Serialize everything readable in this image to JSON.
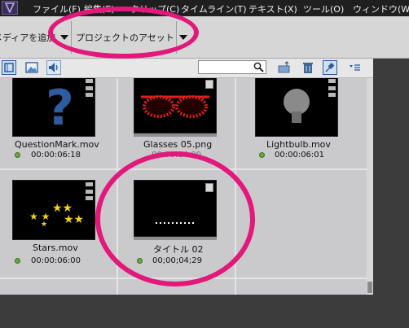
{
  "menu": {
    "items": [
      "ファイル(F)",
      "編集(E)",
      "クリップ(C)",
      "タイムライン(T)",
      "テキスト(X)",
      "ツール(O)",
      "ウィンドウ(W)"
    ]
  },
  "toolbar": {
    "add_media_label": "メディアを追加",
    "project_assets_label": "プロジェクトのアセット"
  },
  "search": {
    "value": ""
  },
  "assets": [
    {
      "name": "QuestionMark.mov",
      "duration": "00:00:06:18",
      "status": "online"
    },
    {
      "name": "Glasses 05.png",
      "duration": "00:00:14:00",
      "status": "online"
    },
    {
      "name": "Lightbulb.mov",
      "duration": "00:00:06:01",
      "status": "online"
    },
    {
      "name": "Stars.mov",
      "duration": "00:00:06:00",
      "status": "online"
    },
    {
      "name": "タイトル 02",
      "duration": "00;00;04;29",
      "status": "online"
    }
  ],
  "colors": {
    "highlight_ring": "#e2187a",
    "status_dot": "#6aa83a"
  }
}
